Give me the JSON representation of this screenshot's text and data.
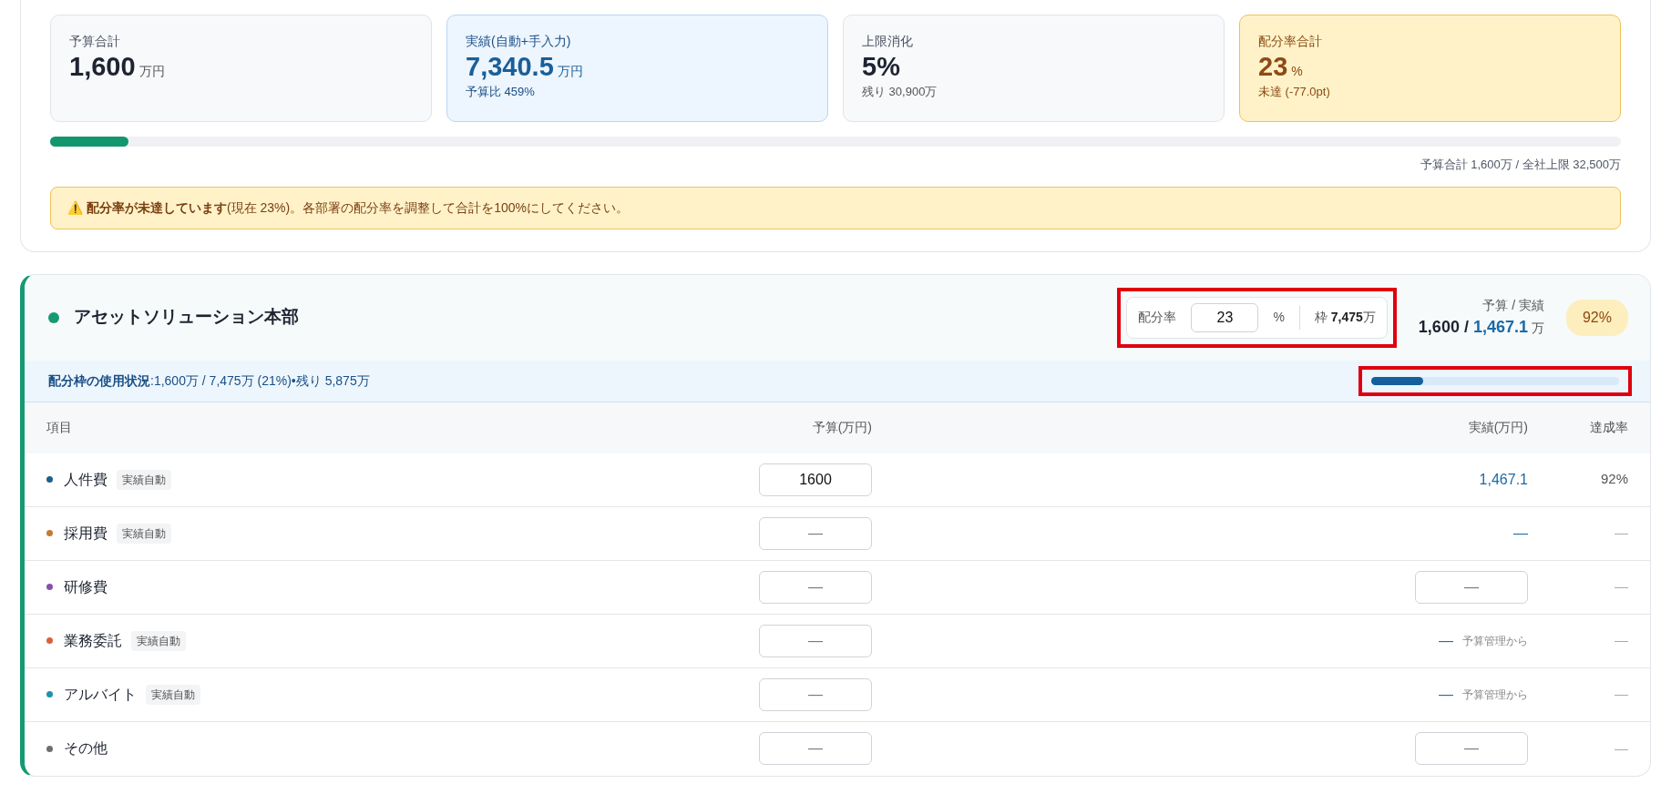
{
  "summary": {
    "cards": [
      {
        "kind": "neutral",
        "label": "予算合計",
        "value": "1,600",
        "unit": "万円"
      },
      {
        "kind": "info",
        "label": "実績(自動+手入力)",
        "value": "7,340.5",
        "unit": "万円",
        "note": "予算比 459%"
      },
      {
        "kind": "neutral",
        "label": "上限消化",
        "value": "5%",
        "note": "残り 30,900万"
      },
      {
        "kind": "warning",
        "label": "配分率合計",
        "value": "23",
        "unit": "%",
        "note": "未達 (-77.0pt)"
      }
    ],
    "cap_bar": {
      "level": 0.05
    },
    "cap_caption": "予算合計 1,600万 / 全社上限 32,500万",
    "alert": {
      "icon": "⚠️",
      "text": "**配分率が未達しています**(現在 23%)。各部署の配分率を調整して合計を100%にしてください。"
    }
  },
  "department": {
    "name": "アセットソリューション本部",
    "color": "#159a73",
    "rate_box": {
      "highlighted": true,
      "label": "配分率",
      "value": "23",
      "unit": "%",
      "frame_label": "枠",
      "frame_value": "7,475",
      "frame_unit": "万"
    },
    "totals": {
      "label": "予算 / 実績",
      "budget": "1,600",
      "separator": " / ",
      "actual": "1,467.1",
      "unit": "万"
    },
    "rate_badge": "92%",
    "usage": {
      "text": "**配分枠の使用状況**:1,600万 / 7,475万 (21%)•残り 5,875万",
      "highlighted": true,
      "level": 0.21
    },
    "table": {
      "columns": [
        "項目",
        "予算(万円)",
        "実績(万円)",
        "達成率"
      ],
      "rows": [
        {
          "name": "人件費",
          "color": "#1d5f8f",
          "tag": "実績自動",
          "budget": {
            "value": "1600"
          },
          "actual": {
            "kind": "text",
            "text": "1,467.1"
          },
          "rate": {
            "text": "92%",
            "muted": false
          }
        },
        {
          "name": "採用費",
          "color": "#c27c35",
          "tag": "実績自動",
          "budget": {
            "placeholder": "—"
          },
          "actual": {
            "kind": "text",
            "text": "—"
          },
          "rate": {
            "text": "—",
            "muted": true
          }
        },
        {
          "name": "研修費",
          "color": "#8a4fae",
          "budget": {
            "placeholder": "—"
          },
          "actual": {
            "kind": "input",
            "placeholder": "—"
          },
          "rate": {
            "text": "—",
            "muted": true
          }
        },
        {
          "name": "業務委託",
          "color": "#d8613c",
          "tag": "実績自動",
          "budget": {
            "placeholder": "—"
          },
          "actual": {
            "kind": "note",
            "text": "—",
            "note": "予算管理から"
          },
          "rate": {
            "text": "—",
            "muted": true
          }
        },
        {
          "name": "アルバイト",
          "color": "#1c93ad",
          "tag": "実績自動",
          "budget": {
            "placeholder": "—"
          },
          "actual": {
            "kind": "note",
            "text": "—",
            "note": "予算管理から"
          },
          "rate": {
            "text": "—",
            "muted": true
          }
        },
        {
          "name": "その他",
          "color": "#6f6f6f",
          "budget": {
            "placeholder": "—"
          },
          "actual": {
            "kind": "input",
            "placeholder": "—"
          },
          "rate": {
            "text": "—",
            "muted": true
          }
        }
      ]
    }
  }
}
